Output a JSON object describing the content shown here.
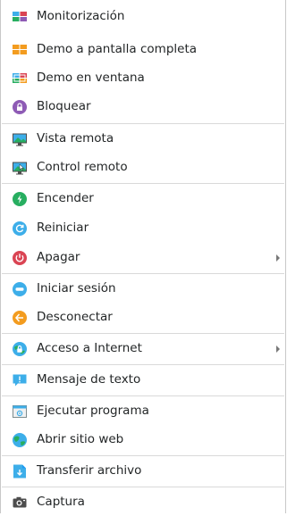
{
  "menu": {
    "items": [
      {
        "label": "Monitorización",
        "icon": "monitoring-grid-icon"
      },
      {
        "label": "Demo a pantalla completa",
        "icon": "fullscreen-demo-icon"
      },
      {
        "label": "Demo en ventana",
        "icon": "window-demo-icon"
      },
      {
        "label": "Bloquear",
        "icon": "lock-icon"
      },
      {
        "label": "Vista remota",
        "icon": "remote-view-icon"
      },
      {
        "label": "Control remoto",
        "icon": "remote-control-icon"
      },
      {
        "label": "Encender",
        "icon": "power-on-icon"
      },
      {
        "label": "Reiniciar",
        "icon": "reboot-icon"
      },
      {
        "label": "Apagar",
        "icon": "power-off-icon",
        "submenu": true
      },
      {
        "label": "Iniciar sesión",
        "icon": "login-icon"
      },
      {
        "label": "Desconectar",
        "icon": "logout-icon"
      },
      {
        "label": "Acceso a Internet",
        "icon": "internet-access-icon",
        "submenu": true
      },
      {
        "label": "Mensaje de texto",
        "icon": "text-message-icon"
      },
      {
        "label": "Ejecutar programa",
        "icon": "run-program-icon"
      },
      {
        "label": "Abrir sitio web",
        "icon": "open-website-icon"
      },
      {
        "label": "Transferir archivo",
        "icon": "file-transfer-icon"
      },
      {
        "label": "Captura",
        "icon": "screenshot-icon"
      }
    ]
  },
  "colors": {
    "green": "#27ae60",
    "blue": "#3daee9",
    "red": "#da4453",
    "orange": "#f39c1f",
    "purple": "#8e5bb5"
  }
}
